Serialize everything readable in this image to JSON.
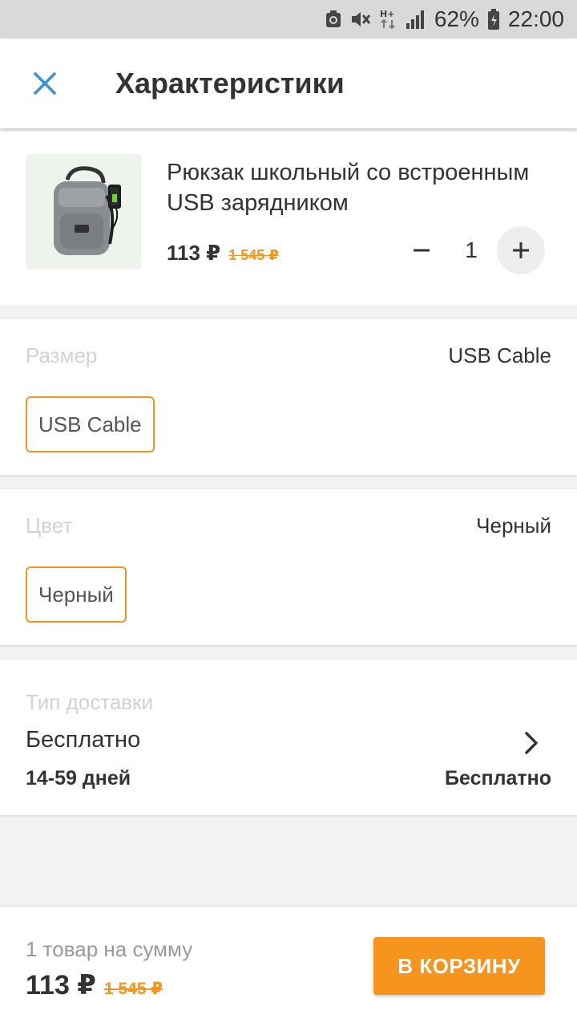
{
  "status_bar": {
    "battery_percent": "62%",
    "time": "22:00",
    "network": "H+",
    "icons": [
      "sync-icon",
      "mute-icon",
      "network-icon",
      "signal-icon",
      "battery-icon"
    ]
  },
  "header": {
    "title": "Характеристики",
    "close_icon": "close-icon"
  },
  "product": {
    "name": "Рюкзак школьный со встроенным USB зарядником",
    "price": "113 ₽",
    "old_price": "1 545 ₽",
    "quantity": "1",
    "minus_label": "−",
    "plus_label": "+"
  },
  "size": {
    "label": "Размер",
    "selected": "USB Cable",
    "options": [
      "USB Cable"
    ]
  },
  "color": {
    "label": "Цвет",
    "selected": "Черный",
    "options": [
      "Черный"
    ]
  },
  "delivery": {
    "label": "Тип доставки",
    "name": "Бесплатно",
    "days": "14-59 дней",
    "price": "Бесплатно"
  },
  "summary": {
    "label": "1 товар на сумму",
    "price": "113 ₽",
    "old_price": "1 545 ₽",
    "cart_button": "В КОРЗИНУ"
  },
  "colors": {
    "accent": "#f7941d",
    "close_icon": "#3d8fd9",
    "text": "#333333",
    "muted": "#d2d2d2"
  }
}
